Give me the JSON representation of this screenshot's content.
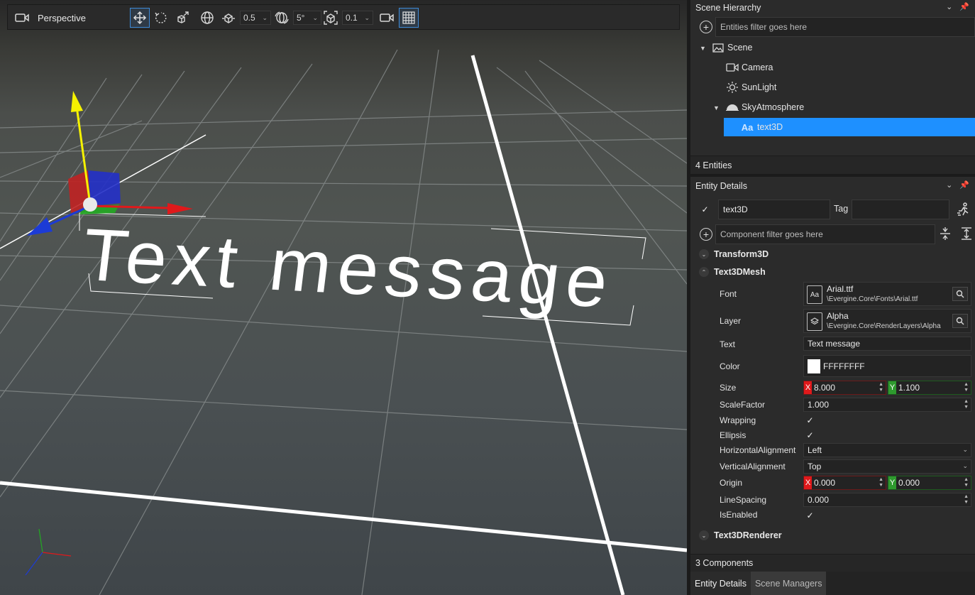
{
  "viewport": {
    "camera_mode": "Perspective",
    "move_snap_value": "0.5",
    "rotate_snap_value": "5°",
    "scale_snap_value": "0.1",
    "scene_text": "Text message",
    "icons": [
      "camera-icon",
      "move-icon",
      "rotate-icon",
      "scale-icon",
      "global-local-icon",
      "move-snap-icon",
      "rotate-snap-icon",
      "scale-snap-icon",
      "camera-settings-icon",
      "grid-icon"
    ]
  },
  "hierarchy": {
    "title": "Scene Hierarchy",
    "filter_placeholder": "Entities filter goes here",
    "items": [
      {
        "label": "Scene",
        "icon": "scene-icon"
      },
      {
        "label": "Camera",
        "icon": "camera-icon"
      },
      {
        "label": "SunLight",
        "icon": "sun-icon"
      },
      {
        "label": "SkyAtmosphere",
        "icon": "sky-icon"
      },
      {
        "label": "text3D",
        "icon": "text-icon"
      }
    ],
    "count_label": "4  Entities"
  },
  "details": {
    "title": "Entity Details",
    "entity_name": "text3D",
    "tag_label": "Tag",
    "tag_value": "",
    "component_filter_placeholder": "Component filter goes here",
    "components": {
      "transform": "Transform3D",
      "mesh": "Text3DMesh",
      "renderer": "Text3DRenderer"
    },
    "props": {
      "font_label": "Font",
      "font_name": "Arial.ttf",
      "font_path": "\\Evergine.Core\\Fonts\\Arial.ttf",
      "layer_label": "Layer",
      "layer_name": "Alpha",
      "layer_path": "\\Evergine.Core\\RenderLayers\\Alpha",
      "text_label": "Text",
      "text_value": "Text message",
      "color_label": "Color",
      "color_value": "FFFFFFFF",
      "size_label": "Size",
      "size_x": "8.000",
      "size_y": "1.100",
      "scale_label": "ScaleFactor",
      "scale_value": "1.000",
      "wrapping_label": "Wrapping",
      "ellipsis_label": "Ellipsis",
      "halign_label": "HorizontalAlignment",
      "halign_value": "Left",
      "valign_label": "VerticalAlignment",
      "valign_value": "Top",
      "origin_label": "Origin",
      "origin_x": "0.000",
      "origin_y": "0.000",
      "linespacing_label": "LineSpacing",
      "linespacing_value": "0.000",
      "isenabled_label": "IsEnabled",
      "x_tag": "X",
      "y_tag": "Y"
    },
    "count_label": "3 Components"
  },
  "tabs": [
    "Entity Details",
    "Scene Managers"
  ],
  "colors": {
    "accent": "#1e90ff",
    "axis_x": "#e0191b",
    "axis_y": "#2e9a2e",
    "gizmo_y": "#f5f200",
    "gizmo_z": "#1c3bd6",
    "text_color": "#ffffff"
  }
}
